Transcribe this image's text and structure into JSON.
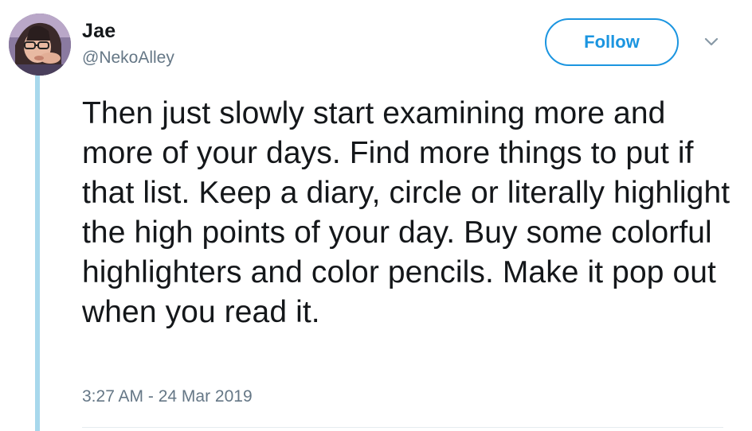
{
  "author": {
    "name": "Jae",
    "handle": "@NekoAlley"
  },
  "actions": {
    "follow_label": "Follow",
    "menu_icon": "chevron-down-icon"
  },
  "tweet": {
    "text": "Then just slowly start examining more and more of your days. Find more things to put if that list. Keep a diary, circle or literally highlight the high points of your day. Buy some colorful highlighters and color pencils. Make it pop out when you read it.",
    "timestamp": "3:27 AM - 24 Mar 2019"
  },
  "colors": {
    "accent": "#1b95e0",
    "thread_line": "#a8d8ec",
    "secondary_text": "#657786",
    "primary_text": "#14171a"
  }
}
